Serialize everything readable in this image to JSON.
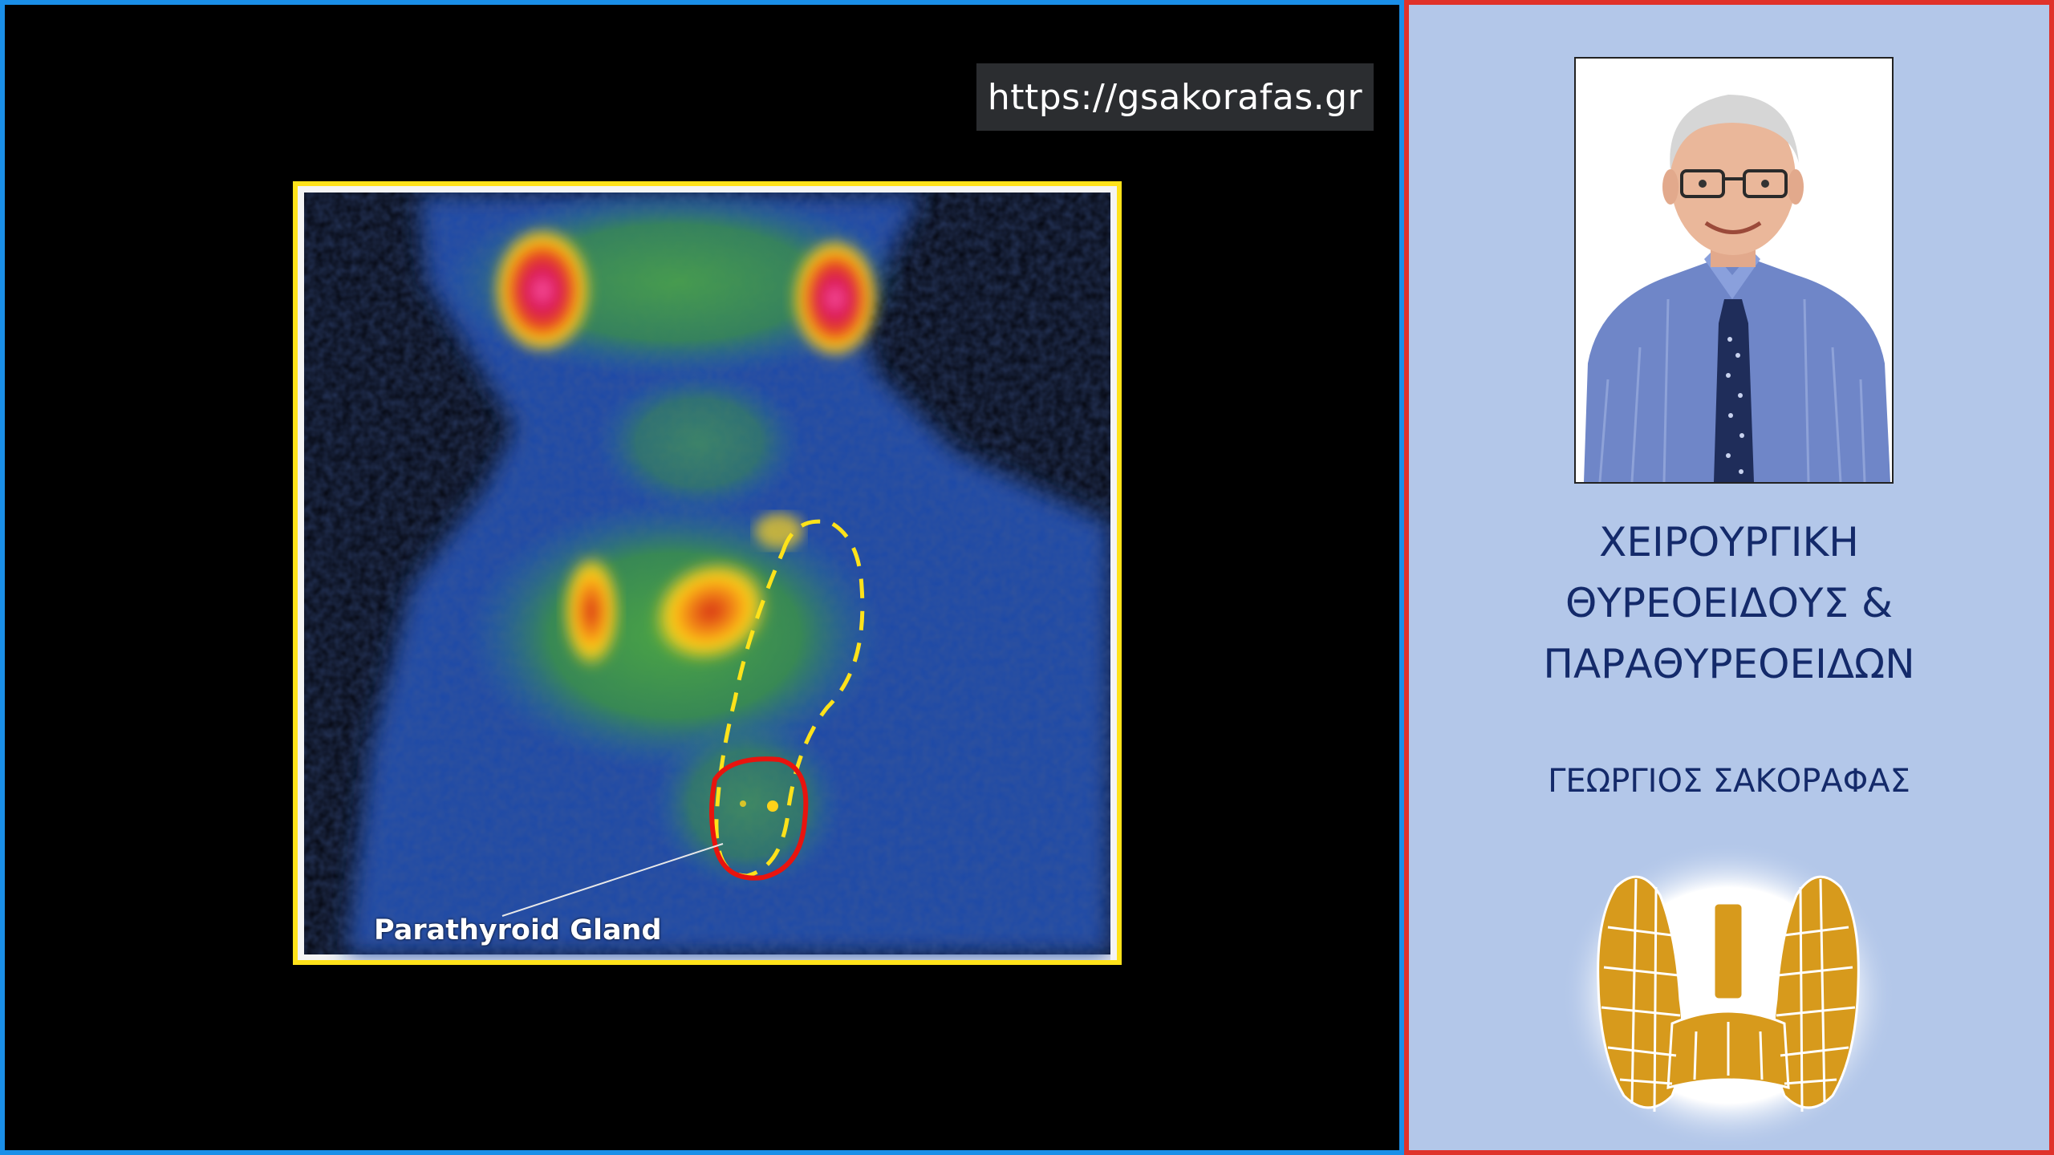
{
  "watermark_url": "https://gsakorafas.gr",
  "scan": {
    "label": "Parathyroid Gland"
  },
  "sidebar": {
    "title_lines": [
      "ΧΕΙΡΟΥΡΓΙΚΗ",
      "ΘΥΡΕΟΕΙΔΟΥΣ &",
      "ΠΑΡΑΘΥΡΕΟΕΙΔΩΝ"
    ],
    "author": "ΓΕΩΡΓΙΟΣ ΣΑΚΟΡΑΦΑΣ"
  },
  "colors": {
    "left_border": "#1a8fe8",
    "right_border": "#e0322a",
    "scan_frame": "#ffe21a",
    "sidebar_bg": "#b3c7e9",
    "title_text": "#142a6a",
    "logo_gold": "#d79a1c"
  },
  "icons": [
    "portrait-photo",
    "thyroid-logo-icon"
  ]
}
